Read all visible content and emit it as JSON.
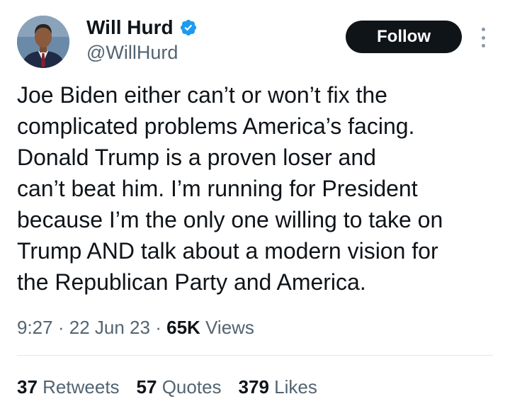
{
  "author": {
    "display_name": "Will Hurd",
    "handle": "@WillHurd",
    "verified": true,
    "verified_color": "#1d9bf0"
  },
  "actions": {
    "follow_label": "Follow",
    "more_icon": "more-vertical-icon"
  },
  "tweet": {
    "lines": [
      "Joe Biden either can’t or won’t fix the",
      "complicated problems America’s facing.",
      "Donald Trump is a proven loser and",
      "can’t beat him. I’m running for President",
      "because I’m the only one willing to take on",
      "Trump AND talk about a modern vision for",
      "the Republican Party and America."
    ]
  },
  "meta": {
    "time": "9:27",
    "separator": "·",
    "date": "22 Jun 23",
    "views_count": "65K",
    "views_label": "Views"
  },
  "stats": {
    "retweets_count": "37",
    "retweets_label": "Retweets",
    "quotes_count": "57",
    "quotes_label": "Quotes",
    "likes_count": "379",
    "likes_label": "Likes"
  },
  "colors": {
    "text_primary": "#0f1419",
    "text_secondary": "#536471",
    "button_bg": "#0f1419"
  }
}
